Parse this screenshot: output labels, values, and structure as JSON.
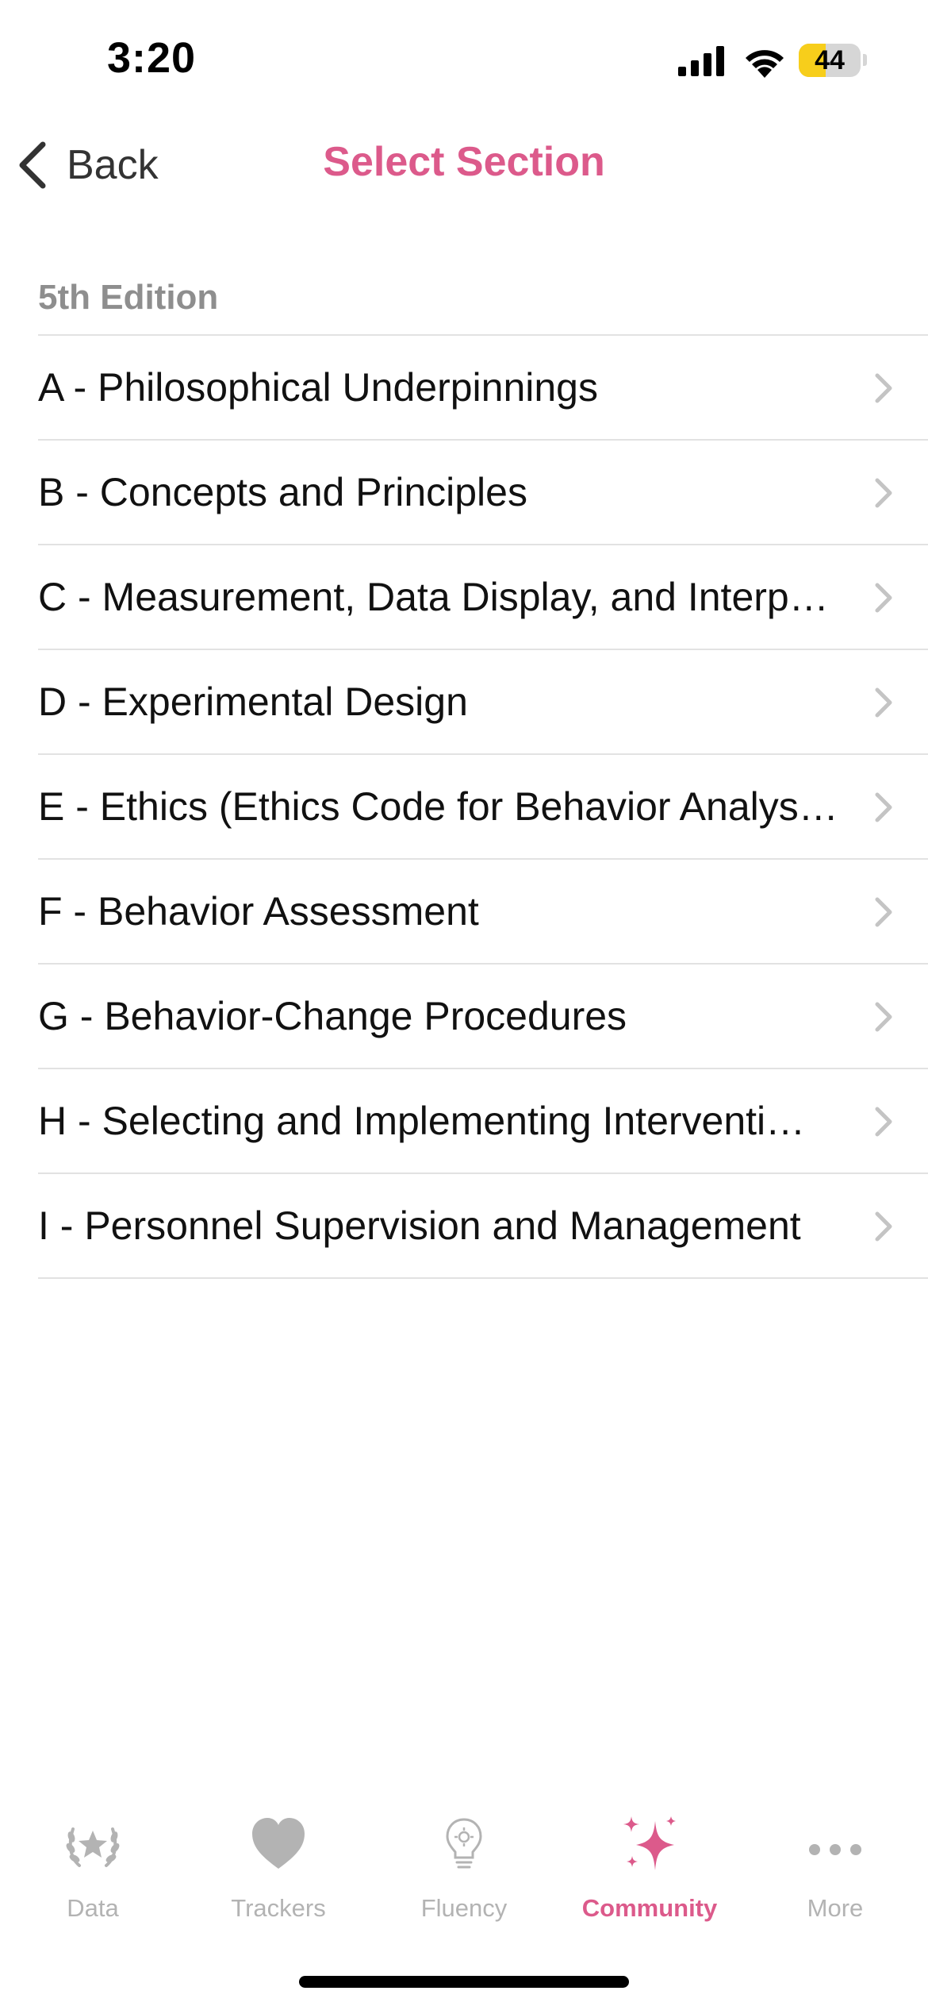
{
  "status_bar": {
    "time": "3:20",
    "battery_level": "44",
    "battery_fraction": 0.44
  },
  "nav": {
    "back_label": "Back",
    "title": "Select Section",
    "title_color": "#dc5a8b"
  },
  "section": {
    "header": "5th Edition",
    "items": [
      {
        "label": "A - Philosophical Underpinnings",
        "icon": "chevron-right-icon"
      },
      {
        "label": "B - Concepts and Principles",
        "icon": "chevron-right-icon"
      },
      {
        "label": "C - Measurement, Data Display, and Interp…",
        "icon": "chevron-right-icon"
      },
      {
        "label": "D - Experimental Design",
        "icon": "chevron-right-icon"
      },
      {
        "label": "E - Ethics (Ethics Code for Behavior Analysts)",
        "icon": "chevron-right-icon"
      },
      {
        "label": "F - Behavior Assessment",
        "icon": "chevron-right-icon"
      },
      {
        "label": "G - Behavior-Change Procedures",
        "icon": "chevron-right-icon"
      },
      {
        "label": "H - Selecting and Implementing Interventi…",
        "icon": "chevron-right-icon"
      },
      {
        "label": "I - Personnel Supervision and Management",
        "icon": "chevron-right-icon"
      }
    ]
  },
  "tab_bar": {
    "active_color": "#dc5a8b",
    "inactive_color": "#b3b3b3",
    "tabs": [
      {
        "label": "Data",
        "icon": "laurel-star-icon",
        "active": false
      },
      {
        "label": "Trackers",
        "icon": "heart-icon",
        "active": false
      },
      {
        "label": "Fluency",
        "icon": "lightbulb-icon",
        "active": false
      },
      {
        "label": "Community",
        "icon": "sparkles-icon",
        "active": true
      },
      {
        "label": "More",
        "icon": "ellipsis-icon",
        "active": false
      }
    ]
  }
}
